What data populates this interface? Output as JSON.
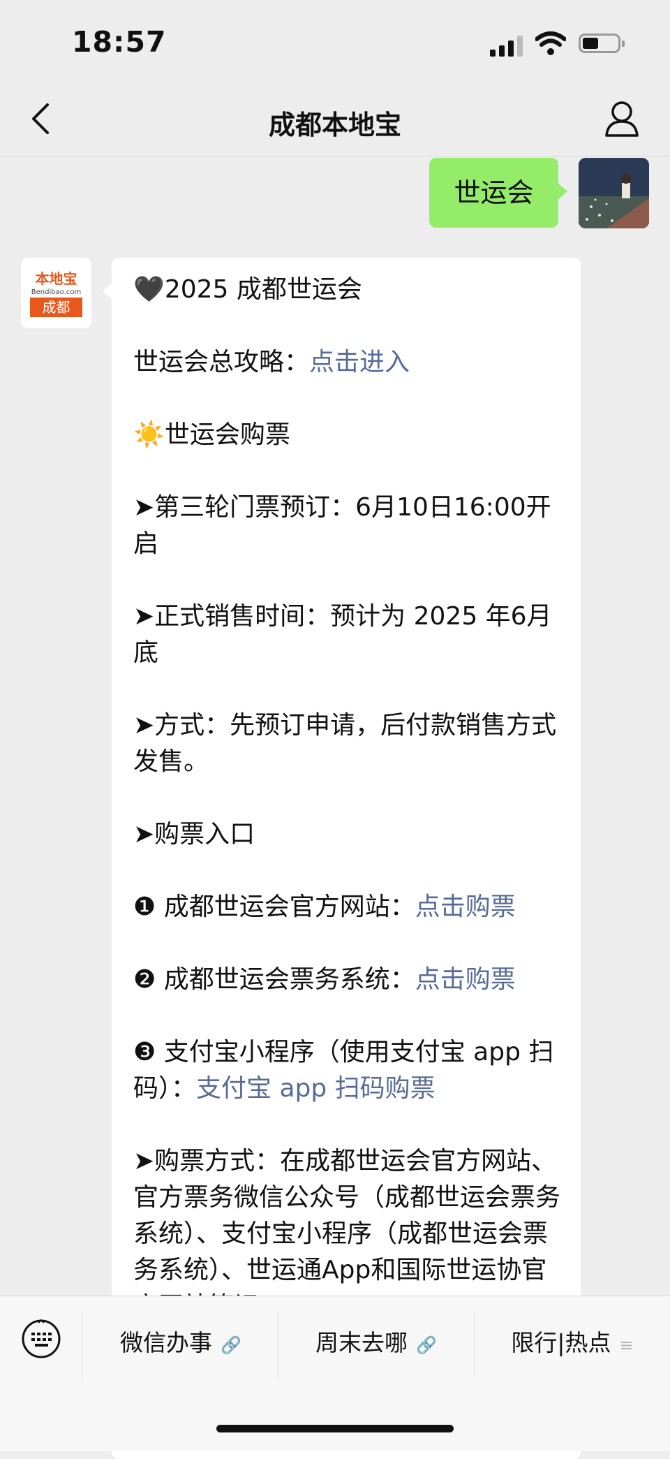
{
  "status_bar": {
    "time": "18:57"
  },
  "nav": {
    "title": "成都本地宝"
  },
  "user_message": {
    "text": "世运会"
  },
  "bot_avatar": {
    "logo_text": "本地宝",
    "logo_url": "Bendibao.com",
    "city": "成都"
  },
  "bot_message": {
    "heading": "🖤2025 成都世运会",
    "guide_label": "世运会总攻略：",
    "guide_link": "点击进入",
    "ticket_heading": "☀️世运会购票",
    "round3": "➤第三轮门票预订：6月10日16:00开启",
    "sale_time": "➤正式销售时间：预计为 2025 年6月底",
    "method": "➤方式：先预订申请，后付款销售方式发售。",
    "entry": "➤购票入口",
    "entry1_label": "❶ 成都世运会官方网站：",
    "entry1_link": "点击购票",
    "entry2_label": "❷ 成都世运会票务系统：",
    "entry2_link": "点击购票",
    "entry3_label": "❸ 支付宝小程序（使用支付宝 app 扫码）：",
    "entry3_link": "支付宝 app 扫码购票",
    "purchase_method": "➤购票方式：在成都世运会官方网站、官方票务微信公众号（成都世运会票务系统）、支付宝小程序（成都世运会票务系统）、世运通App和国际世运协官方网站等记"
  },
  "bottom_menu": {
    "items": [
      {
        "label": "微信办事",
        "icon": "link-icon"
      },
      {
        "label": "周末去哪",
        "icon": "link-icon"
      },
      {
        "label": "限行|热点",
        "icon": "menu-icon"
      }
    ]
  }
}
